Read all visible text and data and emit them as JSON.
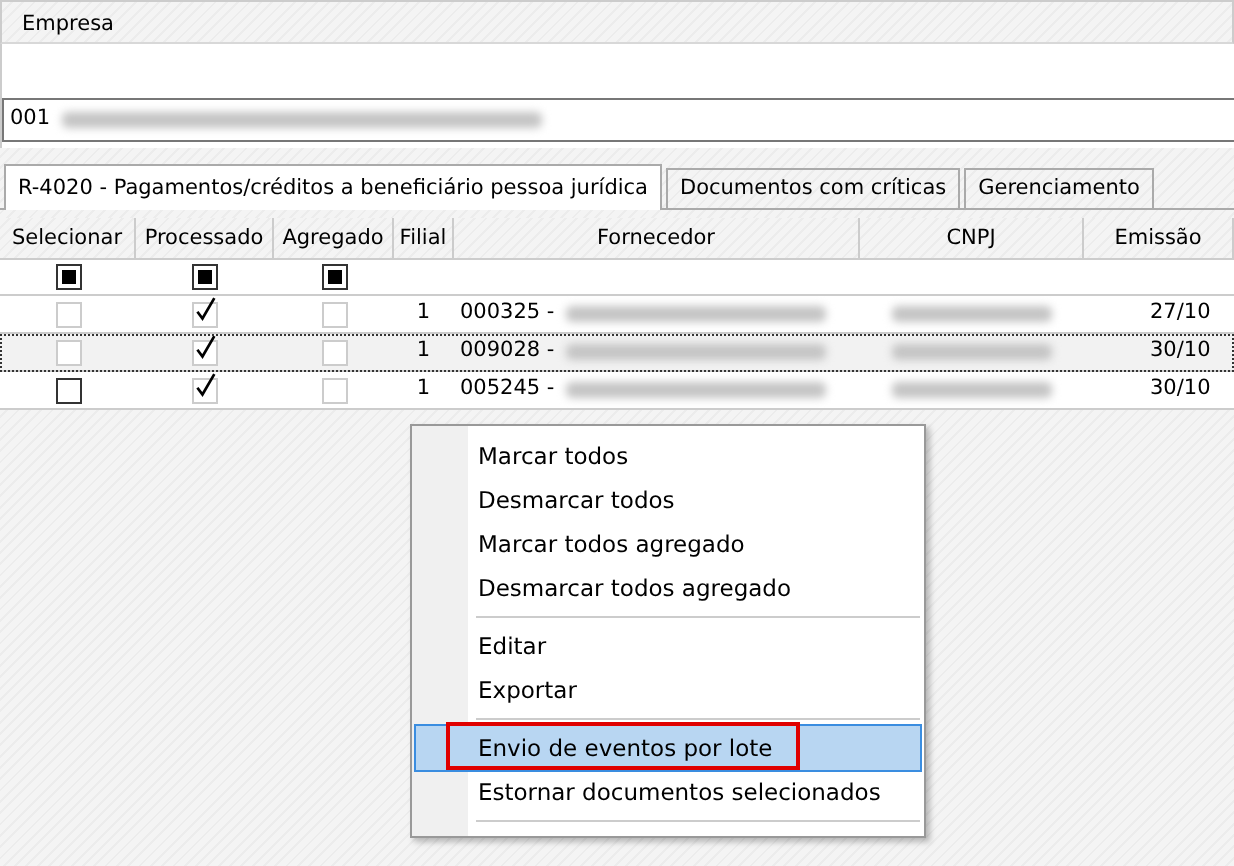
{
  "company": {
    "label": "Empresa",
    "code": "001"
  },
  "tabs": [
    {
      "label": "R-4020 - Pagamentos/créditos a beneficiário pessoa jurídica",
      "selected": true
    },
    {
      "label": "Documentos com críticas",
      "selected": false
    },
    {
      "label": "Gerenciamento",
      "selected": false
    }
  ],
  "table": {
    "columns": [
      "Selecionar",
      "Processado",
      "Agregado",
      "Filial",
      "Fornecedor",
      "CNPJ",
      "Emissão"
    ],
    "filter_checkboxes": [
      {
        "indeterminate": true
      },
      {
        "indeterminate": true
      },
      {
        "indeterminate": true
      }
    ],
    "rows": [
      {
        "focused": false,
        "selecionar": {
          "checked": false,
          "disabled": true
        },
        "processado": {
          "checked": true,
          "disabled": true
        },
        "agregado": {
          "checked": false,
          "disabled": true
        },
        "filial": "1",
        "fornecedor": "000325 -",
        "emissao": "27/10"
      },
      {
        "focused": true,
        "selecionar": {
          "checked": false,
          "disabled": true
        },
        "processado": {
          "checked": true,
          "disabled": true
        },
        "agregado": {
          "checked": false,
          "disabled": true
        },
        "filial": "1",
        "fornecedor": "009028 -",
        "emissao": "30/10"
      },
      {
        "focused": false,
        "selecionar": {
          "checked": false,
          "disabled": false
        },
        "processado": {
          "checked": true,
          "disabled": true
        },
        "agregado": {
          "checked": false,
          "disabled": true
        },
        "filial": "1",
        "fornecedor": "005245 -",
        "emissao": "30/10"
      }
    ]
  },
  "context_menu": [
    {
      "kind": "item",
      "label": "Marcar todos",
      "selected": false,
      "outlined": false
    },
    {
      "kind": "item",
      "label": "Desmarcar todos",
      "selected": false,
      "outlined": false
    },
    {
      "kind": "item",
      "label": "Marcar todos agregado",
      "selected": false,
      "outlined": false
    },
    {
      "kind": "item",
      "label": "Desmarcar todos agregado",
      "selected": false,
      "outlined": false
    },
    {
      "kind": "separator"
    },
    {
      "kind": "item",
      "label": "Editar",
      "selected": false,
      "outlined": false
    },
    {
      "kind": "item",
      "label": "Exportar",
      "selected": false,
      "outlined": false
    },
    {
      "kind": "separator"
    },
    {
      "kind": "item",
      "label": "Envio de eventos por lote",
      "selected": true,
      "outlined": true
    },
    {
      "kind": "item",
      "label": "Estornar documentos selecionados",
      "selected": false,
      "outlined": false
    },
    {
      "kind": "separator"
    }
  ]
}
